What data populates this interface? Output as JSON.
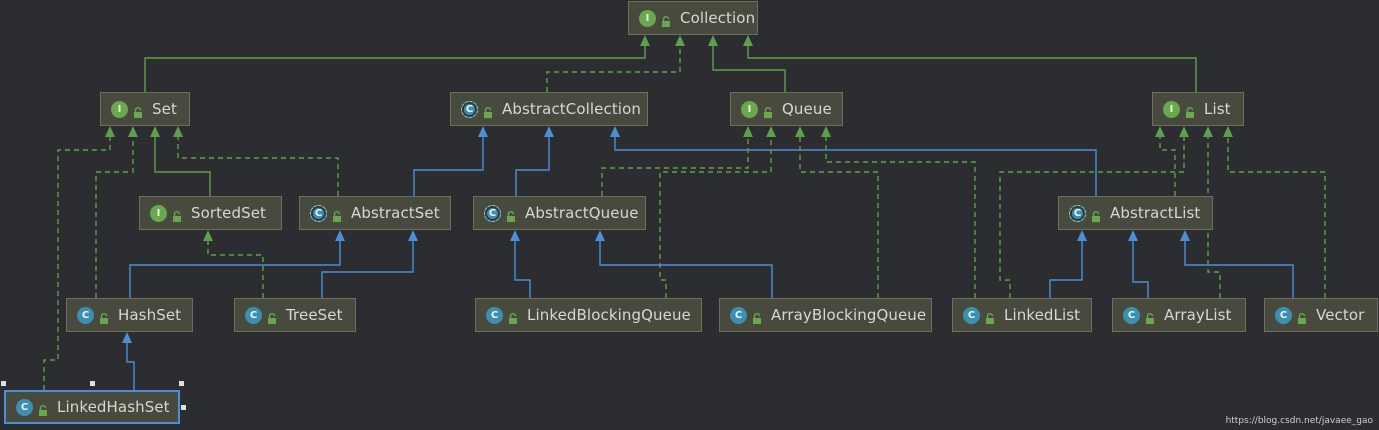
{
  "diagram": {
    "nodes": [
      {
        "id": "Collection",
        "label": "Collection",
        "kind": "interface"
      },
      {
        "id": "Set",
        "label": "Set",
        "kind": "interface"
      },
      {
        "id": "AbstractCollection",
        "label": "AbstractCollection",
        "kind": "abstract"
      },
      {
        "id": "Queue",
        "label": "Queue",
        "kind": "interface"
      },
      {
        "id": "List",
        "label": "List",
        "kind": "interface"
      },
      {
        "id": "SortedSet",
        "label": "SortedSet",
        "kind": "interface"
      },
      {
        "id": "AbstractSet",
        "label": "AbstractSet",
        "kind": "abstract"
      },
      {
        "id": "AbstractQueue",
        "label": "AbstractQueue",
        "kind": "abstract"
      },
      {
        "id": "AbstractList",
        "label": "AbstractList",
        "kind": "abstract"
      },
      {
        "id": "HashSet",
        "label": "HashSet",
        "kind": "class"
      },
      {
        "id": "TreeSet",
        "label": "TreeSet",
        "kind": "class"
      },
      {
        "id": "LinkedBlockingQueue",
        "label": "LinkedBlockingQueue",
        "kind": "class"
      },
      {
        "id": "ArrayBlockingQueue",
        "label": "ArrayBlockingQueue",
        "kind": "class"
      },
      {
        "id": "LinkedList",
        "label": "LinkedList",
        "kind": "class"
      },
      {
        "id": "ArrayList",
        "label": "ArrayList",
        "kind": "class"
      },
      {
        "id": "Vector",
        "label": "Vector",
        "kind": "class"
      },
      {
        "id": "LinkedHashSet",
        "label": "LinkedHashSet",
        "kind": "class",
        "selected": true
      }
    ],
    "edges": [
      {
        "from": "Set",
        "to": "Collection",
        "type": "extends"
      },
      {
        "from": "Queue",
        "to": "Collection",
        "type": "extends"
      },
      {
        "from": "List",
        "to": "Collection",
        "type": "extends"
      },
      {
        "from": "AbstractCollection",
        "to": "Collection",
        "type": "implements"
      },
      {
        "from": "SortedSet",
        "to": "Set",
        "type": "extends"
      },
      {
        "from": "AbstractSet",
        "to": "Set",
        "type": "implements"
      },
      {
        "from": "HashSet",
        "to": "Set",
        "type": "implements"
      },
      {
        "from": "LinkedHashSet",
        "to": "Set",
        "type": "implements"
      },
      {
        "from": "AbstractSet",
        "to": "AbstractCollection",
        "type": "extends"
      },
      {
        "from": "AbstractQueue",
        "to": "AbstractCollection",
        "type": "extends"
      },
      {
        "from": "AbstractList",
        "to": "AbstractCollection",
        "type": "extends"
      },
      {
        "from": "AbstractQueue",
        "to": "Queue",
        "type": "implements"
      },
      {
        "from": "LinkedBlockingQueue",
        "to": "Queue",
        "type": "implements"
      },
      {
        "from": "ArrayBlockingQueue",
        "to": "Queue",
        "type": "implements"
      },
      {
        "from": "LinkedList",
        "to": "Queue",
        "type": "implements"
      },
      {
        "from": "AbstractList",
        "to": "List",
        "type": "implements"
      },
      {
        "from": "LinkedList",
        "to": "List",
        "type": "implements"
      },
      {
        "from": "ArrayList",
        "to": "List",
        "type": "implements"
      },
      {
        "from": "Vector",
        "to": "List",
        "type": "implements"
      },
      {
        "from": "TreeSet",
        "to": "SortedSet",
        "type": "implements"
      },
      {
        "from": "HashSet",
        "to": "AbstractSet",
        "type": "extends"
      },
      {
        "from": "TreeSet",
        "to": "AbstractSet",
        "type": "extends"
      },
      {
        "from": "LinkedBlockingQueue",
        "to": "AbstractQueue",
        "type": "extends"
      },
      {
        "from": "ArrayBlockingQueue",
        "to": "AbstractQueue",
        "type": "extends"
      },
      {
        "from": "LinkedList",
        "to": "AbstractList",
        "type": "extends"
      },
      {
        "from": "ArrayList",
        "to": "AbstractList",
        "type": "extends"
      },
      {
        "from": "Vector",
        "to": "AbstractList",
        "type": "extends"
      },
      {
        "from": "LinkedHashSet",
        "to": "HashSet",
        "type": "extends"
      }
    ]
  },
  "badges": {
    "interface": "I",
    "class": "C",
    "abstract": "C"
  },
  "colors": {
    "extends_interface": "#5f9e4a",
    "implements": "#5f9e4a",
    "extends_class": "#4b8fd6",
    "background": "#2b2d30",
    "node_fill": "#474a3c"
  },
  "watermark": "https://blog.csdn.net/javaee_gao"
}
